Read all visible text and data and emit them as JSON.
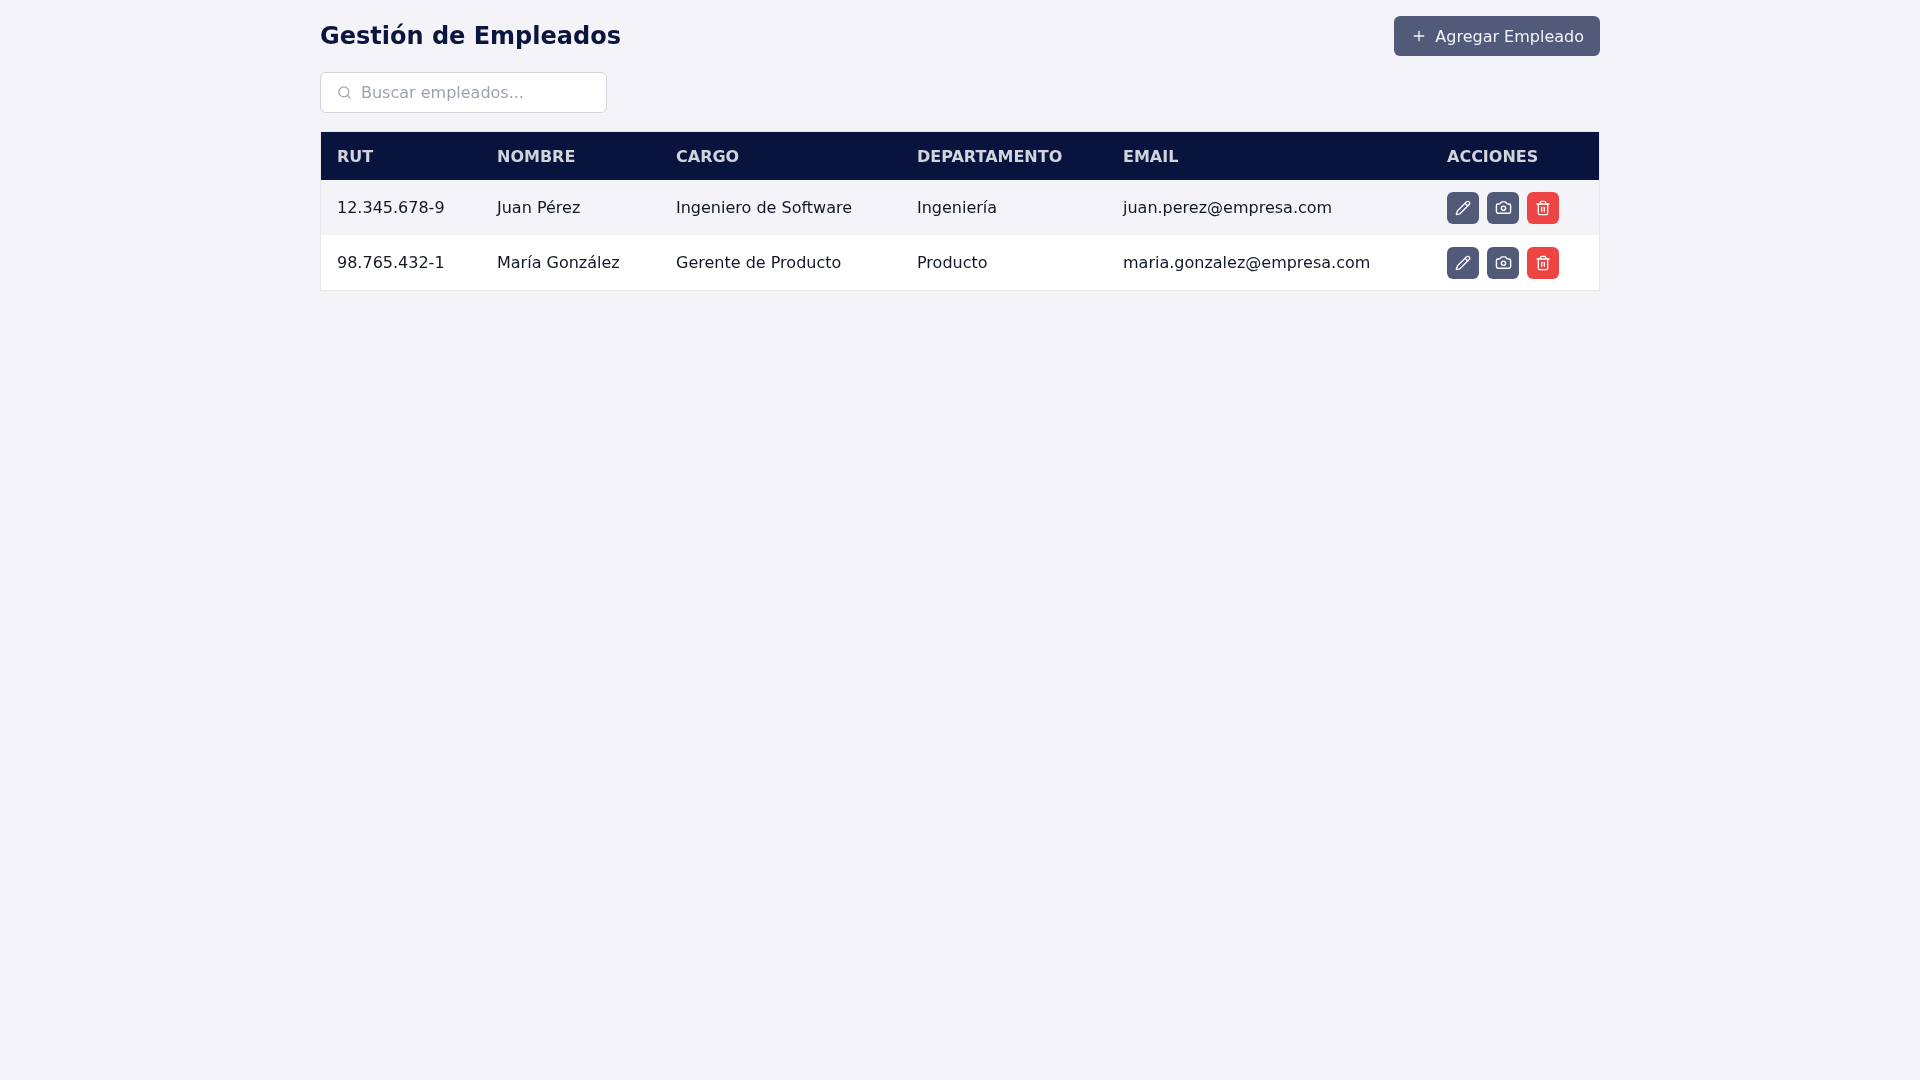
{
  "header": {
    "title": "Gestión de Empleados",
    "add_button": {
      "label": "Agregar Empleado"
    }
  },
  "search": {
    "placeholder": "Buscar empleados..."
  },
  "table": {
    "columns": [
      "RUT",
      "NOMBRE",
      "CARGO",
      "DEPARTAMENTO",
      "EMAIL",
      "ACCIONES"
    ],
    "rows": [
      {
        "cells": [
          "12.345.678-9",
          "Juan Pérez",
          "Ingeniero de Software",
          "Ingeniería",
          "juan.perez@empresa.com"
        ]
      },
      {
        "cells": [
          "98.765.432-1",
          "María González",
          "Gerente de Producto",
          "Producto",
          "maria.gonzalez@empresa.com"
        ]
      }
    ]
  }
}
